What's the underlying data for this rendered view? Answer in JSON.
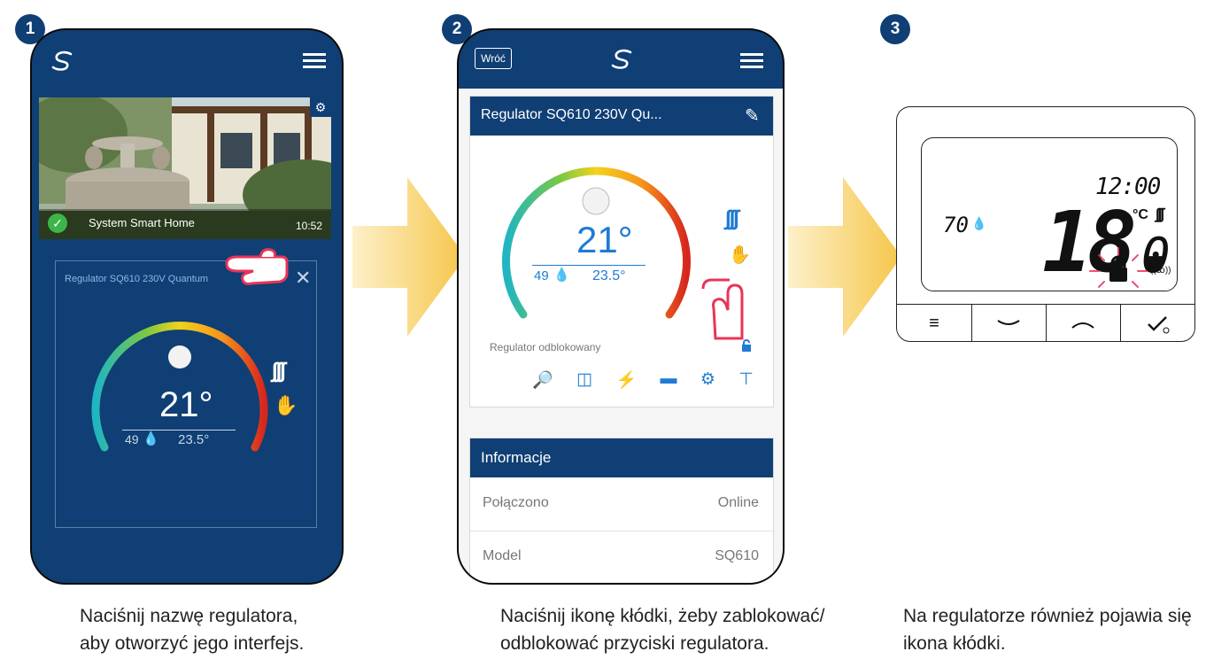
{
  "steps": [
    {
      "number": "1",
      "caption_line1": "Naciśnij nazwę regulatora,",
      "caption_line2": "aby otworzyć jego interfejs."
    },
    {
      "number": "2",
      "caption_line1": "Naciśnij ikonę kłódki, żeby zablokować/",
      "caption_line2": "odblokować przyciski regulatora."
    },
    {
      "number": "3",
      "caption_line1": "Na regulatorze również pojawia się",
      "caption_line2": "ikona kłódki."
    }
  ],
  "screen1": {
    "location_name": "System Smart Home",
    "time": "10:52",
    "device_title": "Regulator SQ610 230V Quantum",
    "setpoint": "21°",
    "humidity": "49",
    "current_temp": "23.5°"
  },
  "screen2": {
    "back_label": "Wróć",
    "device_title": "Regulator SQ610 230V Qu...",
    "setpoint": "21°",
    "humidity": "49",
    "current_temp": "23.5°",
    "status_text": "Regulator odblokowany",
    "info_header": "Informacje",
    "info_rows": [
      {
        "label": "Połączono",
        "value": "Online"
      },
      {
        "label": "Model",
        "value": "SQ610"
      }
    ]
  },
  "thermostat": {
    "clock": "12:00",
    "humidity": "70",
    "temp_big": "18.",
    "temp_decimal": "0",
    "unit": "°C"
  },
  "colors": {
    "brand": "#0f3f74",
    "accent": "#1f7bd3",
    "arrow": "#f5c64a",
    "alert": "#e8345a"
  }
}
